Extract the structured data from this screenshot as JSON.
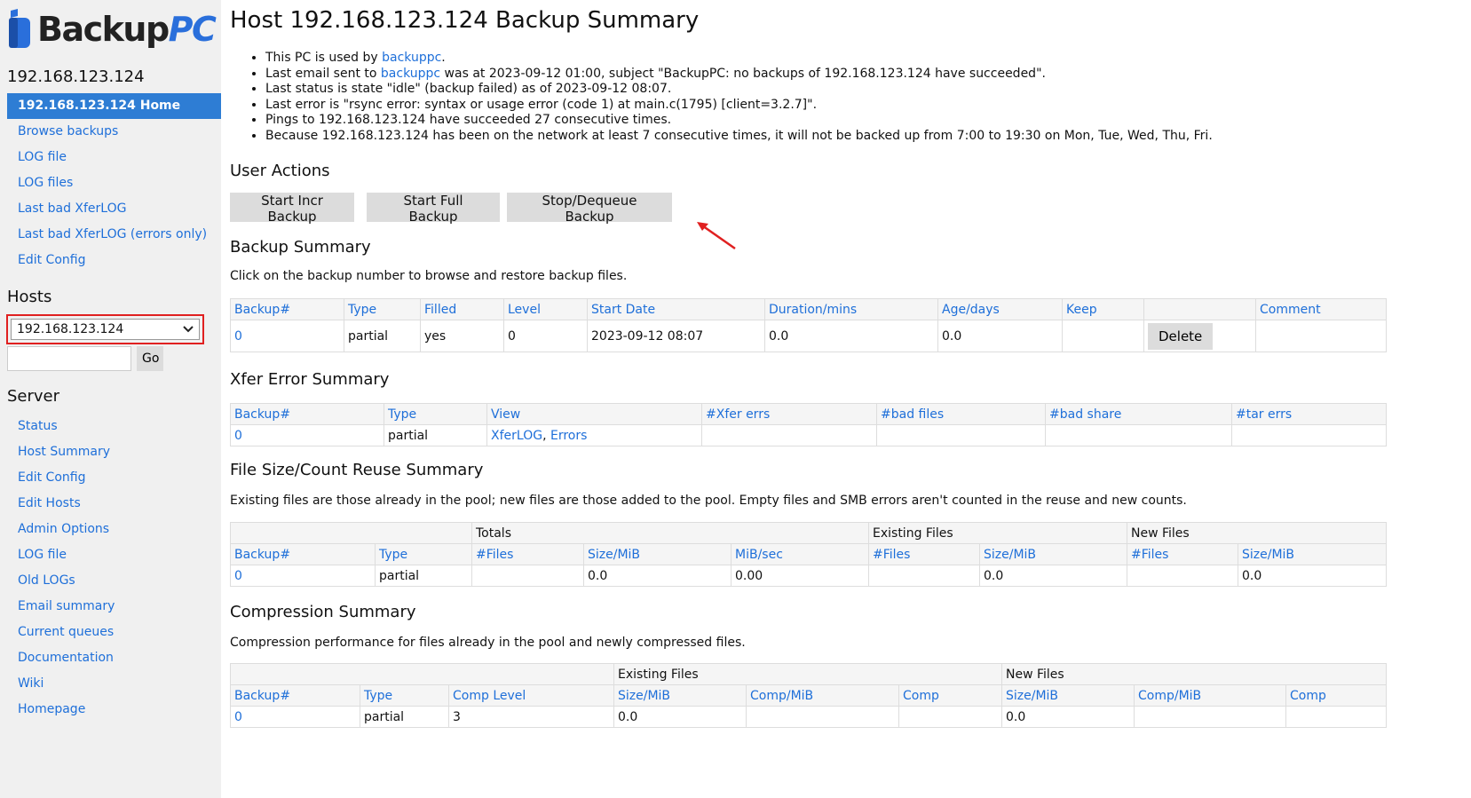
{
  "logo": {
    "part1": "Backup",
    "part2": "PC"
  },
  "sidebar": {
    "host_title": "192.168.123.124",
    "host_nav": [
      "192.168.123.124 Home",
      "Browse backups",
      "LOG file",
      "LOG files",
      "Last bad XferLOG",
      "Last bad XferLOG (errors only)",
      "Edit Config"
    ],
    "hosts_title": "Hosts",
    "host_select_value": "192.168.123.124",
    "go_label": "Go",
    "server_title": "Server",
    "server_nav": [
      "Status",
      "Host Summary",
      "Edit Config",
      "Edit Hosts",
      "Admin Options",
      "LOG file",
      "Old LOGs",
      "Email summary",
      "Current queues",
      "Documentation",
      "Wiki",
      "Homepage"
    ]
  },
  "main": {
    "title": "Host 192.168.123.124 Backup Summary",
    "info": {
      "l1_pre": "This PC is used by ",
      "l1_link": "backuppc",
      "l1_post": ".",
      "l2_pre": "Last email sent to ",
      "l2_link": "backuppc",
      "l2_post": " was at 2023-09-12 01:00, subject \"BackupPC: no backups of 192.168.123.124 have succeeded\".",
      "l3": "Last status is state \"idle\" (backup failed) as of 2023-09-12 08:07.",
      "l4": "Last error is \"rsync error: syntax or usage error (code 1) at main.c(1795) [client=3.2.7]\".",
      "l5": "Pings to 192.168.123.124 have succeeded 27 consecutive times.",
      "l6": "Because 192.168.123.124 has been on the network at least 7 consecutive times, it will not be backed up from 7:00 to 19:30 on Mon, Tue, Wed, Thu, Fri."
    },
    "user_actions_title": "User Actions",
    "buttons": {
      "incr": "Start Incr Backup",
      "full": "Start Full Backup",
      "stop": "Stop/Dequeue Backup"
    },
    "backup_summary": {
      "title": "Backup Summary",
      "desc": "Click on the backup number to browse and restore backup files.",
      "headers": [
        "Backup#",
        "Type",
        "Filled",
        "Level",
        "Start Date",
        "Duration/mins",
        "Age/days",
        "Keep",
        "",
        "Comment"
      ],
      "row": {
        "num": "0",
        "type": "partial",
        "filled": "yes",
        "level": "0",
        "start": "2023-09-12 08:07",
        "duration": "0.0",
        "age": "0.0",
        "keep": "",
        "delete": "Delete",
        "comment": ""
      }
    },
    "xfer": {
      "title": "Xfer Error Summary",
      "headers": [
        "Backup#",
        "Type",
        "View",
        "#Xfer errs",
        "#bad files",
        "#bad share",
        "#tar errs"
      ],
      "row": {
        "num": "0",
        "type": "partial",
        "view_link1": "XferLOG",
        "view_sep": ", ",
        "view_link2": "Errors",
        "xfer": "",
        "badfiles": "",
        "badshare": "",
        "tar": ""
      }
    },
    "reuse": {
      "title": "File Size/Count Reuse Summary",
      "desc": "Existing files are those already in the pool; new files are those added to the pool. Empty files and SMB errors aren't counted in the reuse and new counts.",
      "groups": {
        "totals": "Totals",
        "existing": "Existing Files",
        "new": "New Files"
      },
      "headers": [
        "Backup#",
        "Type",
        "#Files",
        "Size/MiB",
        "MiB/sec",
        "#Files",
        "Size/MiB",
        "#Files",
        "Size/MiB"
      ],
      "row": [
        "0",
        "partial",
        "",
        "0.0",
        "0.00",
        "",
        "0.0",
        "",
        "0.0"
      ]
    },
    "compression": {
      "title": "Compression Summary",
      "desc": "Compression performance for files already in the pool and newly compressed files.",
      "groups": {
        "existing": "Existing Files",
        "new": "New Files"
      },
      "headers": [
        "Backup#",
        "Type",
        "Comp Level",
        "Size/MiB",
        "Comp/MiB",
        "Comp",
        "Size/MiB",
        "Comp/MiB",
        "Comp"
      ],
      "row": [
        "0",
        "partial",
        "3",
        "0.0",
        "",
        "",
        "0.0",
        "",
        ""
      ]
    }
  }
}
